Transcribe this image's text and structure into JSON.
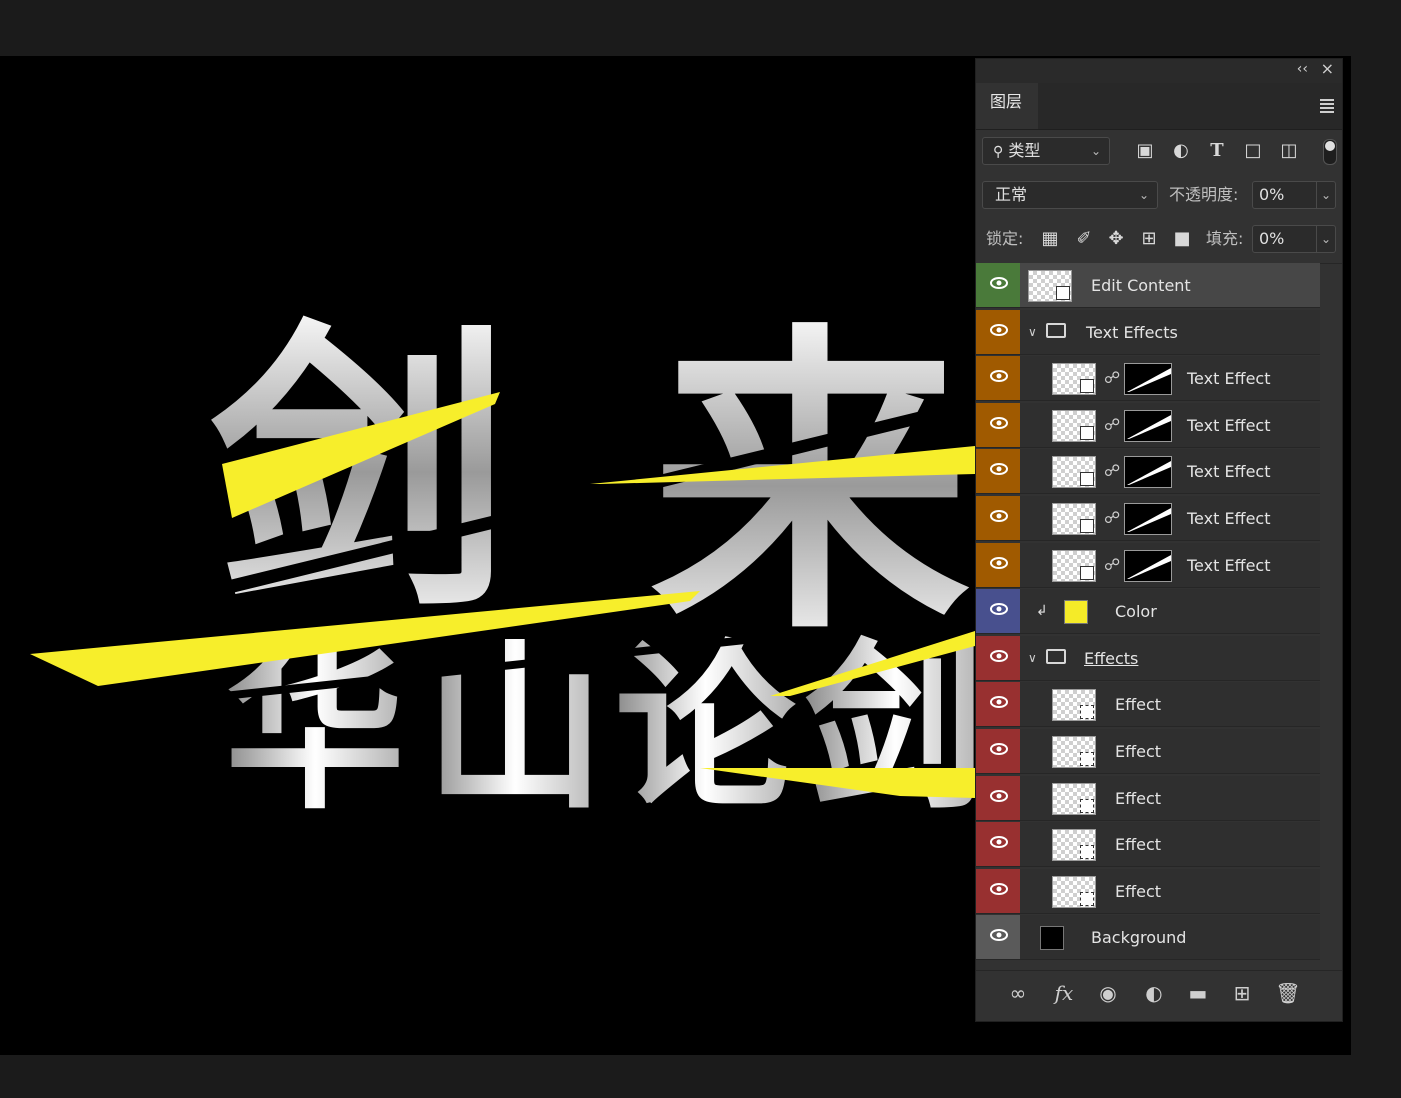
{
  "panel": {
    "tab_label": "图层",
    "collapse_label": "‹‹",
    "close_label": "×",
    "filter_label": "类型",
    "blend_mode": "正常",
    "opacity_label": "不透明度:",
    "opacity_value": "0%",
    "lock_label": "锁定:",
    "fill_label": "填充:",
    "fill_value": "0%"
  },
  "tag_colors": {
    "green": "#4a7a3a",
    "orange": "#a05a00",
    "blue": "#48508e",
    "red": "#983030",
    "gray": "#5a5a5a"
  },
  "layers": [
    {
      "name": "Edit Content",
      "kind": "smart",
      "tag": "green",
      "selected": true
    },
    {
      "name": "Text Effects",
      "kind": "group",
      "tag": "orange"
    },
    {
      "name": "Text Effect",
      "kind": "smart-masked",
      "tag": "orange"
    },
    {
      "name": "Text Effect",
      "kind": "smart-masked",
      "tag": "orange"
    },
    {
      "name": "Text Effect",
      "kind": "smart-masked",
      "tag": "orange"
    },
    {
      "name": "Text Effect",
      "kind": "smart-masked",
      "tag": "orange"
    },
    {
      "name": "Text Effect",
      "kind": "smart-masked",
      "tag": "orange"
    },
    {
      "name": "Color",
      "kind": "fill",
      "tag": "blue",
      "swatch": "#f5eb28"
    },
    {
      "name": "Effects",
      "kind": "group",
      "tag": "red"
    },
    {
      "name": "Effect",
      "kind": "smart-transform",
      "tag": "red"
    },
    {
      "name": "Effect",
      "kind": "smart-transform",
      "tag": "red"
    },
    {
      "name": "Effect",
      "kind": "smart-transform",
      "tag": "red"
    },
    {
      "name": "Effect",
      "kind": "smart-transform",
      "tag": "red"
    },
    {
      "name": "Effect",
      "kind": "smart-transform",
      "tag": "red"
    },
    {
      "name": "Background",
      "kind": "background",
      "tag": "gray",
      "swatch": "#000000"
    }
  ],
  "canvas": {
    "title_line1": [
      "剑",
      "来"
    ],
    "title_line2": [
      "华",
      "山",
      "论",
      "剑"
    ],
    "accent": "#f7ee2b"
  },
  "footer_icons": [
    "link-icon",
    "fx-icon",
    "mask-icon",
    "adjustment-icon",
    "folder-icon",
    "new-layer-icon",
    "trash-icon"
  ],
  "footer_labels": {
    "fx": "fx"
  }
}
